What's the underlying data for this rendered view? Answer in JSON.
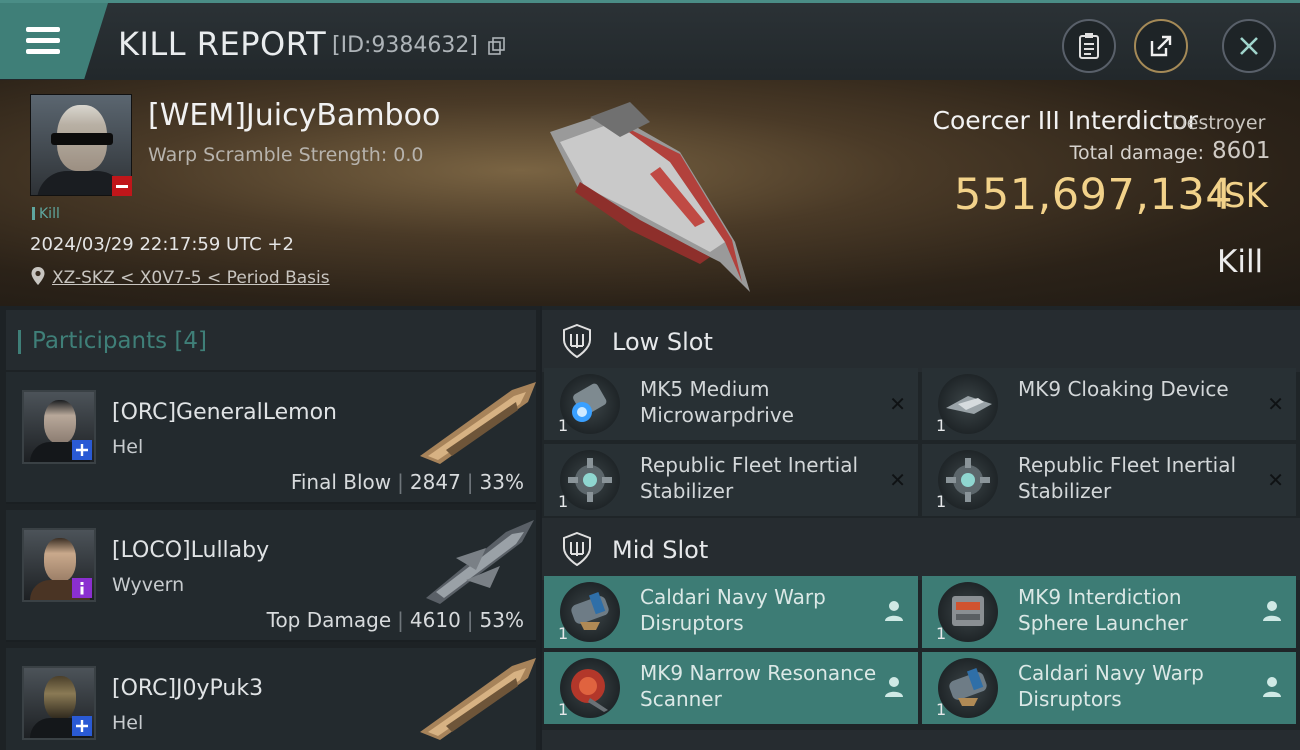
{
  "header": {
    "title": "KILL REPORT",
    "report_id": "[ID:9384632]"
  },
  "victim": {
    "name": "[WEM]JuicyBamboo",
    "warp_scramble": "Warp Scramble Strength: 0.0",
    "kill_tag": "Kill",
    "datetime": "2024/03/29 22:17:59 UTC +2",
    "location": "XZ-SKZ < X0V7-5 < Period Basis",
    "ship_name": "Coercer III Interdictor",
    "ship_class": "Destroyer",
    "total_damage_label": "Total damage:",
    "total_damage": "8601",
    "isk_value": "551,697,134",
    "isk_unit": "ISK",
    "kill_type": "Kill"
  },
  "participants": {
    "title": "Participants",
    "count": "[4]",
    "rows": [
      {
        "name": "[ORC]GeneralLemon",
        "ship": "Hel",
        "role": "Final Blow",
        "damage": "2847",
        "percent": "33%",
        "badge": "blue"
      },
      {
        "name": "[LOCO]Lullaby",
        "ship": "Wyvern",
        "role": "Top Damage",
        "damage": "4610",
        "percent": "53%",
        "badge": "purple"
      },
      {
        "name": "[ORC]J0yPuk3",
        "ship": "Hel",
        "role": "",
        "damage": "",
        "percent": "",
        "badge": "blue"
      }
    ]
  },
  "slots": {
    "low": {
      "title": "Low Slot",
      "items": [
        {
          "name": "MK5 Medium Microwarpdrive",
          "qty": "1",
          "state": "destroyed"
        },
        {
          "name": "MK9 Cloaking Device",
          "qty": "1",
          "state": "destroyed"
        },
        {
          "name": "Republic Fleet Inertial Stabilizer",
          "qty": "1",
          "state": "destroyed"
        },
        {
          "name": "Republic Fleet Inertial Stabilizer",
          "qty": "1",
          "state": "destroyed"
        }
      ]
    },
    "mid": {
      "title": "Mid Slot",
      "items": [
        {
          "name": "Caldari Navy Warp Disruptors",
          "qty": "1",
          "state": "dropped"
        },
        {
          "name": "MK9 Interdiction Sphere Launcher",
          "qty": "1",
          "state": "dropped"
        },
        {
          "name": "MK9 Narrow Resonance Scanner",
          "qty": "1",
          "state": "dropped"
        },
        {
          "name": "Caldari Navy Warp Disruptors",
          "qty": "1",
          "state": "dropped"
        }
      ]
    }
  },
  "colors": {
    "accent": "#3f7f78",
    "isk": "#f2d28a",
    "destroyed_marker": "#0f1214"
  }
}
